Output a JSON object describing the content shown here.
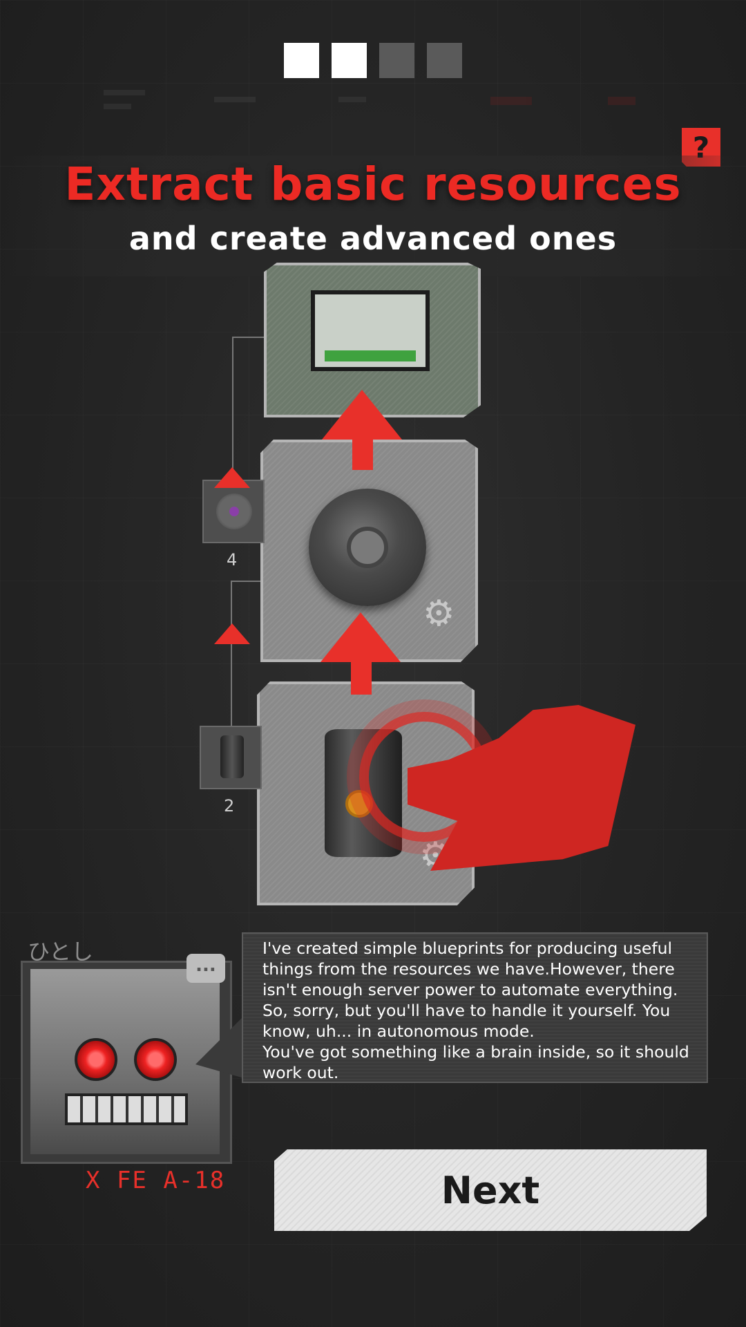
{
  "pager": {
    "total": 4,
    "active": [
      true,
      true,
      false,
      false
    ]
  },
  "help": {
    "label": "?"
  },
  "title": {
    "main": "Extract basic resources",
    "sub": "and create advanced ones"
  },
  "chain": {
    "disk_count": "4",
    "barrel_count": "2"
  },
  "dialogue": {
    "speaker_name": "ひとし",
    "speaker_tag": "X FE A-18",
    "chat_icon": "...",
    "text": "I've created simple blueprints for producing useful\nthings from the resources we have.However, there\nisn't enough server power to automate everything.\nSo, sorry, but you'll have to handle it yourself. You\nknow, uh... in autonomous mode.\nYou've got something like a brain inside, so it should\nwork out."
  },
  "next_button": {
    "label": "Next"
  },
  "colors": {
    "accent": "#e8302a",
    "panel": "#8a8a8a",
    "background": "#232323"
  }
}
